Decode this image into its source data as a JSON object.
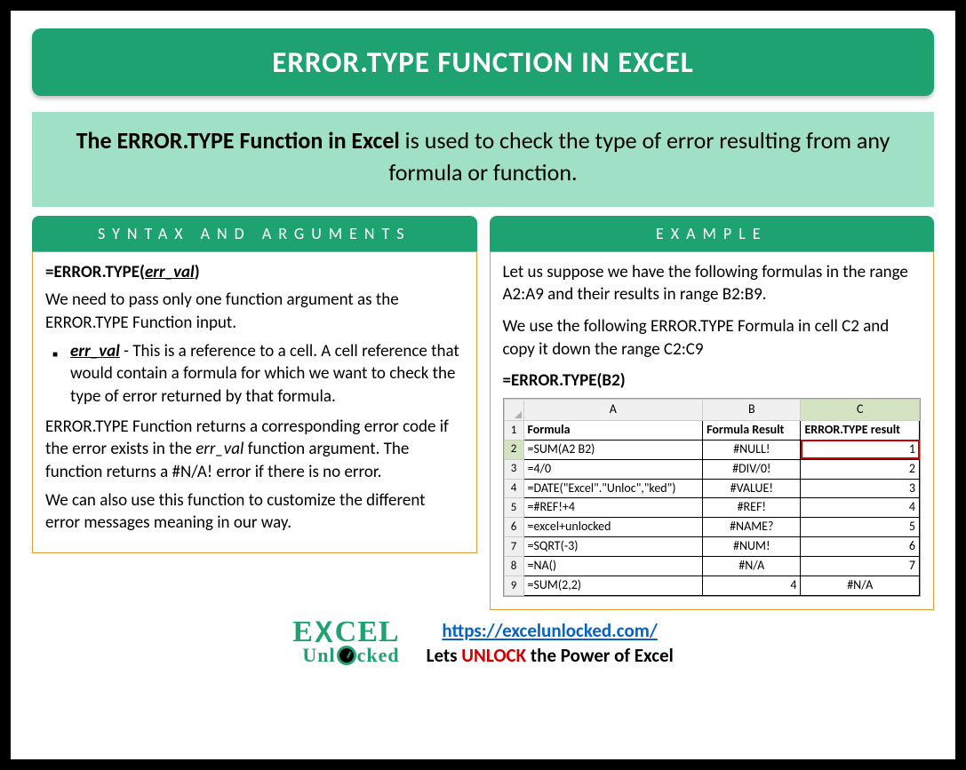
{
  "title": "ERROR.TYPE FUNCTION IN EXCEL",
  "intro_bold": "The ERROR.TYPE Function in Excel",
  "intro_rest": " is used to check the type of error resulting from any formula or function.",
  "left": {
    "header": "SYNTAX AND ARGUMENTS",
    "syntax_prefix": "=ERROR.TYPE(",
    "syntax_arg": "err_val",
    "syntax_suffix": ")",
    "p1": "We need to pass only one function argument as the ERROR.TYPE Function input.",
    "arg_name": "err_val",
    "arg_desc": " -  This is a reference to a cell. A cell reference that would contain a formula for which we want to check the type of error returned by that formula.",
    "p2a": "ERROR.TYPE Function returns a corresponding error code if the error exists in the ",
    "p2b": "err_val",
    "p2c": " function argument. The function returns a #N/A! error if there is no error.",
    "p3": "We can also use this function to customize the different error messages meaning in our way."
  },
  "right": {
    "header": "EXAMPLE",
    "p1": "Let us suppose we have the following formulas in the range A2:A9 and their results in range B2:B9.",
    "p2": "We use the following ERROR.TYPE Formula in cell C2 and copy it down the range C2:C9",
    "formula": "=ERROR.TYPE(B2)"
  },
  "chart_data": {
    "type": "table",
    "columns": [
      "A",
      "B",
      "C"
    ],
    "header_row": [
      "Formula",
      "Formula Result",
      "ERROR.TYPE result"
    ],
    "rows": [
      {
        "n": "2",
        "a": "=SUM(A2 B2)",
        "b": "#NULL!",
        "c": "1",
        "sel": true
      },
      {
        "n": "3",
        "a": "=4/0",
        "b": "#DIV/0!",
        "c": "2"
      },
      {
        "n": "4",
        "a": "=DATE(\"Excel\".\"Unloc\",\"ked\")",
        "b": "#VALUE!",
        "c": "3"
      },
      {
        "n": "5",
        "a": "=#REF!+4",
        "b": "#REF!",
        "c": "4"
      },
      {
        "n": "6",
        "a": "=excel+unlocked",
        "b": "#NAME?",
        "c": "5"
      },
      {
        "n": "7",
        "a": "=SQRT(-3)",
        "b": "#NUM!",
        "c": "6"
      },
      {
        "n": "8",
        "a": "=NA()",
        "b": "#N/A",
        "c": "7"
      },
      {
        "n": "9",
        "a": "=SUM(2,2)",
        "b": "4",
        "c": "#N/A",
        "b_right": true,
        "c_center": true
      }
    ]
  },
  "footer": {
    "logo_top": "E  CEL",
    "logo_bot": "Unl  cked",
    "url": "https://excelunlocked.com/",
    "tag_pre": "Lets ",
    "tag_unlock": "UNLOCK",
    "tag_post": " the Power of Excel"
  }
}
